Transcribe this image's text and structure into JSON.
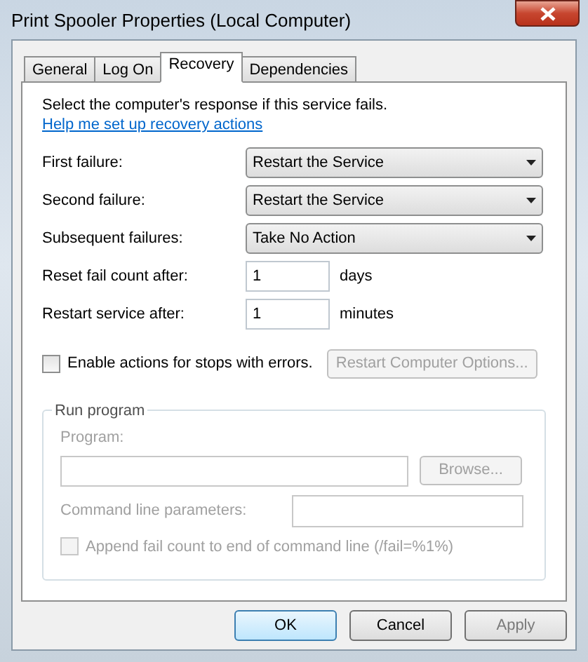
{
  "window": {
    "title": "Print Spooler Properties (Local Computer)"
  },
  "tabs": [
    {
      "label": "General",
      "selected": false
    },
    {
      "label": "Log On",
      "selected": false
    },
    {
      "label": "Recovery",
      "selected": true
    },
    {
      "label": "Dependencies",
      "selected": false
    }
  ],
  "intro": {
    "text": "Select the computer's response if this service fails.",
    "link": "Help me set up recovery actions"
  },
  "failure_actions": [
    {
      "label": "First failure:",
      "value": "Restart the Service"
    },
    {
      "label": "Second failure:",
      "value": "Restart the Service"
    },
    {
      "label": "Subsequent failures:",
      "value": "Take No Action"
    }
  ],
  "timers": [
    {
      "label": "Reset fail count after:",
      "value": "1",
      "unit": "days"
    },
    {
      "label": "Restart service after:",
      "value": "1",
      "unit": "minutes"
    }
  ],
  "stop_errors": {
    "label": "Enable actions for stops with errors.",
    "checked": false
  },
  "restart_options_button": {
    "label": "Restart Computer Options...",
    "disabled": true
  },
  "run_program": {
    "title": "Run program",
    "disabled": true,
    "program_label": "Program:",
    "browse_label": "Browse...",
    "params_label": "Command line parameters:",
    "append": {
      "label": "Append fail count to end of command line (/fail=%1%)",
      "checked": false
    }
  },
  "buttons": [
    {
      "label": "OK",
      "kind": "default",
      "disabled": false
    },
    {
      "label": "Cancel",
      "kind": "normal",
      "disabled": false
    },
    {
      "label": "Apply",
      "kind": "normal",
      "disabled": true
    }
  ]
}
